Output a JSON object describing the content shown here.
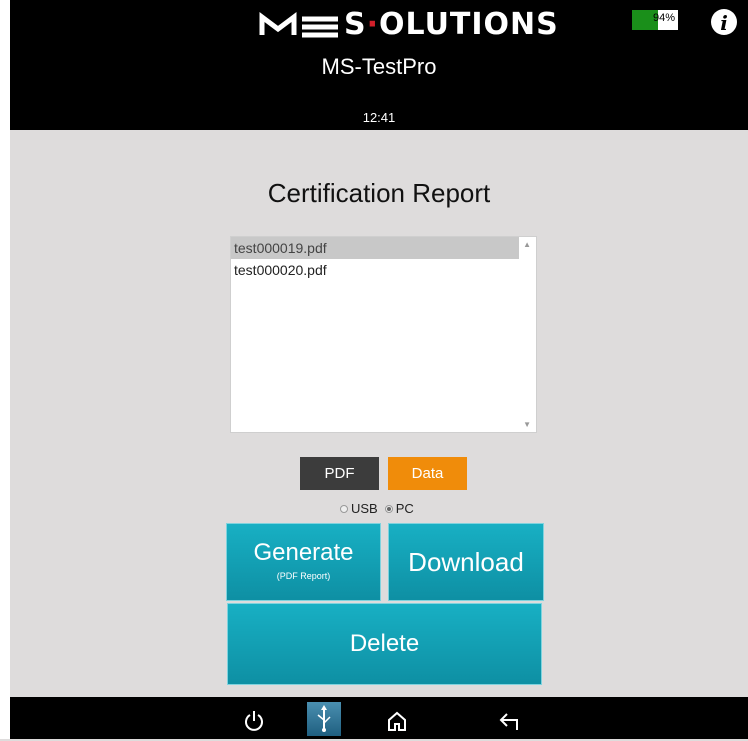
{
  "header": {
    "logo_text_a": "S",
    "logo_text_b": "OLUTIONS",
    "app_title": "MS-TestPro",
    "time": "12:41",
    "battery_percent": 0.94,
    "battery_label": "94%",
    "info_icon": "info-icon"
  },
  "main": {
    "title": "Certification Report",
    "files": [
      {
        "name": "test000019.pdf",
        "selected": true
      },
      {
        "name": "test000020.pdf",
        "selected": false
      }
    ],
    "format_toggle": {
      "pdf_label": "PDF",
      "data_label": "Data",
      "selected": "Data"
    },
    "destination": {
      "usb_label": "USB",
      "pc_label": "PC",
      "selected": "PC"
    },
    "buttons": {
      "generate_label": "Generate",
      "generate_sub": "(PDF Report)",
      "download_label": "Download",
      "delete_label": "Delete"
    }
  },
  "navbar": {
    "icons": [
      "power-icon",
      "usb-icon",
      "home-icon",
      "back-icon"
    ]
  },
  "colors": {
    "accent": "#12a0b4",
    "data_toggle": "#f08c0a",
    "pdf_toggle": "#3c3c3c",
    "battery": "#1a8f1a",
    "background": "#dedcdc"
  }
}
